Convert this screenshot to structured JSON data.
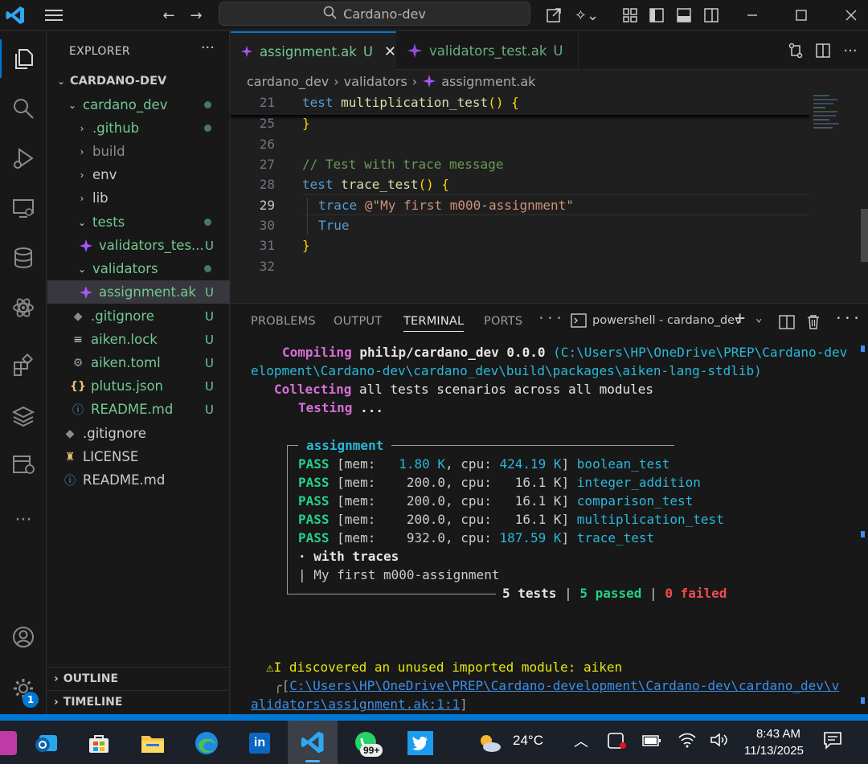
{
  "titlebar": {
    "search_text": "Cardano-dev"
  },
  "sidebar": {
    "header": "EXPLORER",
    "root": "CARDANO-DEV",
    "tree": [
      {
        "label": "cardano_dev",
        "status": "dot"
      },
      {
        "label": ".github",
        "status": "dot"
      },
      {
        "label": "build",
        "status": ""
      },
      {
        "label": "env",
        "status": ""
      },
      {
        "label": "lib",
        "status": ""
      },
      {
        "label": "tests",
        "status": "dot"
      },
      {
        "label": "validators_tes...",
        "status": "U"
      },
      {
        "label": "validators",
        "status": "dot"
      },
      {
        "label": "assignment.ak",
        "status": "U"
      },
      {
        "label": ".gitignore",
        "status": "U"
      },
      {
        "label": "aiken.lock",
        "status": "U"
      },
      {
        "label": "aiken.toml",
        "status": "U"
      },
      {
        "label": "plutus.json",
        "status": "U"
      },
      {
        "label": "README.md",
        "status": "U"
      },
      {
        "label": ".gitignore",
        "status": ""
      },
      {
        "label": "LICENSE",
        "status": ""
      },
      {
        "label": "README.md",
        "status": ""
      }
    ],
    "outline": "OUTLINE",
    "timeline": "TIMELINE",
    "settings_badge": "1"
  },
  "tabs": [
    {
      "label": "assignment.ak",
      "status": "U"
    },
    {
      "label": "validators_test.ak",
      "status": "U"
    }
  ],
  "breadcrumb": [
    "cardano_dev",
    "validators",
    "assignment.ak"
  ],
  "editor": {
    "lines": [
      {
        "num": "21",
        "a": "test",
        "b": " multiplication_test",
        "c": "() {"
      },
      {
        "num": "25",
        "a": "",
        "b": "",
        "c": "}"
      },
      {
        "num": "26",
        "a": "",
        "b": "",
        "c": ""
      },
      {
        "num": "27",
        "comment": "// Test with trace message"
      },
      {
        "num": "28",
        "a": "test",
        "b": " trace_test",
        "c": "() {"
      },
      {
        "num": "29",
        "trace_kw": "trace",
        "trace_str": "@\"My first m000-assignment\""
      },
      {
        "num": "30",
        "true_kw": "True"
      },
      {
        "num": "31",
        "a": "",
        "b": "",
        "c": "}"
      },
      {
        "num": "32",
        "a": "",
        "b": "",
        "c": ""
      }
    ]
  },
  "panel": {
    "tabs": [
      "PROBLEMS",
      "OUTPUT",
      "TERMINAL",
      "PORTS"
    ],
    "shell": "powershell - cardano_dev",
    "compiling_kw": "Compiling",
    "compiling_pkg": "philip/cardano_dev 0.0.0",
    "compiling_path_1": "(C:\\Users\\HP\\OneDrive\\PREP\\Cardano-dev",
    "compiling_path_2": "elopment\\Cardano-dev\\cardano_dev\\build\\packages\\aiken-lang-stdlib)",
    "collecting_kw": "Collecting",
    "collecting_text": "all tests scenarios across all modules",
    "testing_kw": "Testing",
    "testing_text": "...",
    "module": "assignment",
    "results": [
      {
        "status": "PASS",
        "mem": "  1.80 K",
        "cpu": "424.19 K",
        "name": "boolean_test"
      },
      {
        "status": "PASS",
        "mem": "   200.0",
        "cpu": "  16.1 K",
        "name": "integer_addition"
      },
      {
        "status": "PASS",
        "mem": "   200.0",
        "cpu": "  16.1 K",
        "name": "comparison_test"
      },
      {
        "status": "PASS",
        "mem": "   200.0",
        "cpu": "  16.1 K",
        "name": "multiplication_test"
      },
      {
        "status": "PASS",
        "mem": "   932.0",
        "cpu": "187.59 K",
        "name": "trace_test"
      }
    ],
    "with_traces": "· with traces",
    "trace_msg": "| My first m000-assignment",
    "summary_tests": "5 tests",
    "summary_passed": "5 passed",
    "summary_failed": "0 failed",
    "warning_text": "I discovered an unused imported module: aiken",
    "warning_link_1": "C:\\Users\\HP\\OneDrive\\PREP\\Cardano-development\\Cardano-dev\\cardano_dev\\v",
    "warning_link_2": "alidators\\assignment.ak:1:1"
  },
  "taskbar": {
    "weather": "24°C",
    "time": "8:43 AM",
    "date": "11/13/2025",
    "whatsapp_badge": "99+"
  },
  "colors": {
    "accent": "#0078d4",
    "git_untracked": "#73c991",
    "pass": "#23d18b",
    "fail": "#f14c4c"
  }
}
